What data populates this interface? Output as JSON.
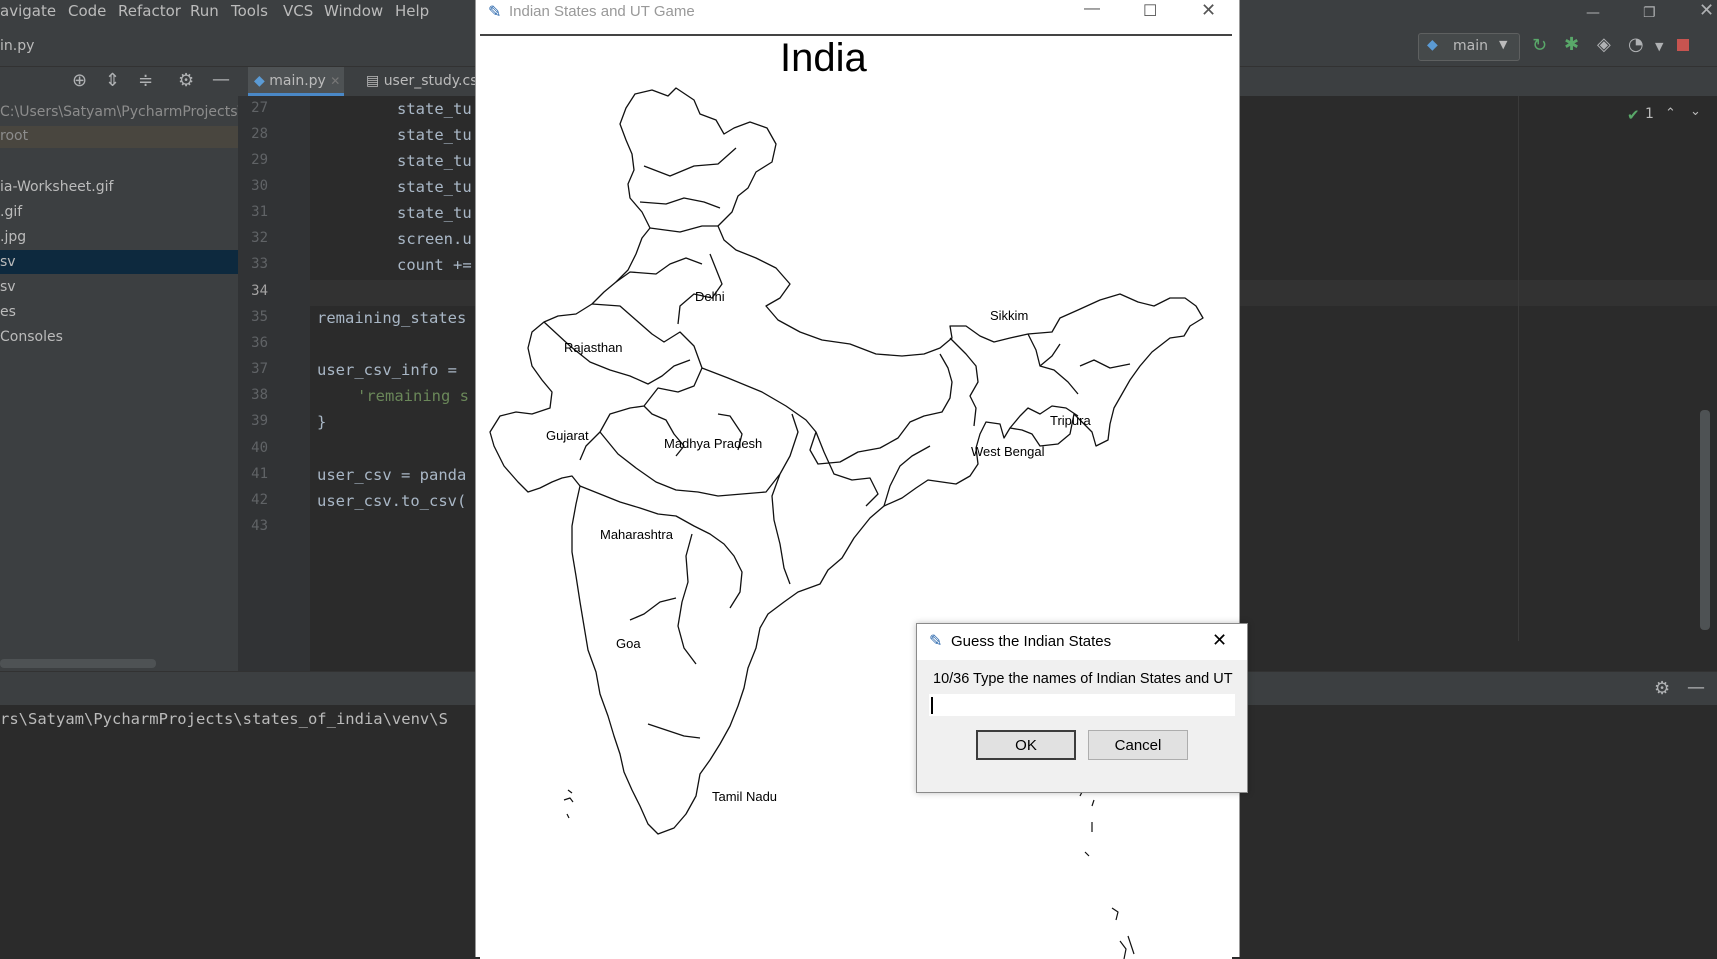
{
  "ide": {
    "menu": [
      "avigate",
      "Code",
      "Refactor",
      "Run",
      "Tools",
      "VCS",
      "Window",
      "Help"
    ],
    "breadcrumb": "in.py",
    "run_config": "main",
    "tabs": [
      "main.py",
      "user_study.cs"
    ],
    "project_path": "C:\\Users\\Satyam\\PycharmProjects\\",
    "project_tree": [
      "root",
      "ia-Worksheet.gif",
      ".gif",
      ".jpg",
      "sv",
      "sv",
      "es",
      "Consoles"
    ],
    "line_numbers": [
      "27",
      "28",
      "29",
      "30",
      "31",
      "32",
      "33",
      "34",
      "35",
      "36",
      "37",
      "38",
      "39",
      "40",
      "41",
      "42",
      "43"
    ],
    "code_lines": {
      "l27": "state_tu",
      "l28": "state_tu",
      "l29": "state_tu",
      "l30": "state_tu",
      "l31": "state_tu",
      "l32": "screen.u",
      "l33": "count +=",
      "l35": "remaining_states",
      "l37": "user_csv_info = ",
      "l38": "'remaining s",
      "l39": "}",
      "l41": "user_csv = panda",
      "l42": "user_csv.to_csv("
    },
    "inspection_count": "1",
    "console_path": "rs\\Satyam\\PycharmProjects\\states_of_india\\venv\\S",
    "colors": {
      "bg": "#2b2b2b",
      "panel": "#3c3f41",
      "string": "#6a8759"
    }
  },
  "game": {
    "window_title": "Indian States and UT Game",
    "map_title": "India",
    "labels": [
      "Delhi",
      "Sikkim",
      "Rajasthan",
      "Tripura",
      "Gujarat",
      "Madhya Pradesh",
      "West Bengal",
      "Maharashtra",
      "Goa",
      "Tamil Nadu"
    ]
  },
  "dialog": {
    "title": "Guess the Indian States",
    "prompt": "10/36 Type the names of Indian States and UT",
    "input_value": "",
    "ok_label": "OK",
    "cancel_label": "Cancel"
  }
}
